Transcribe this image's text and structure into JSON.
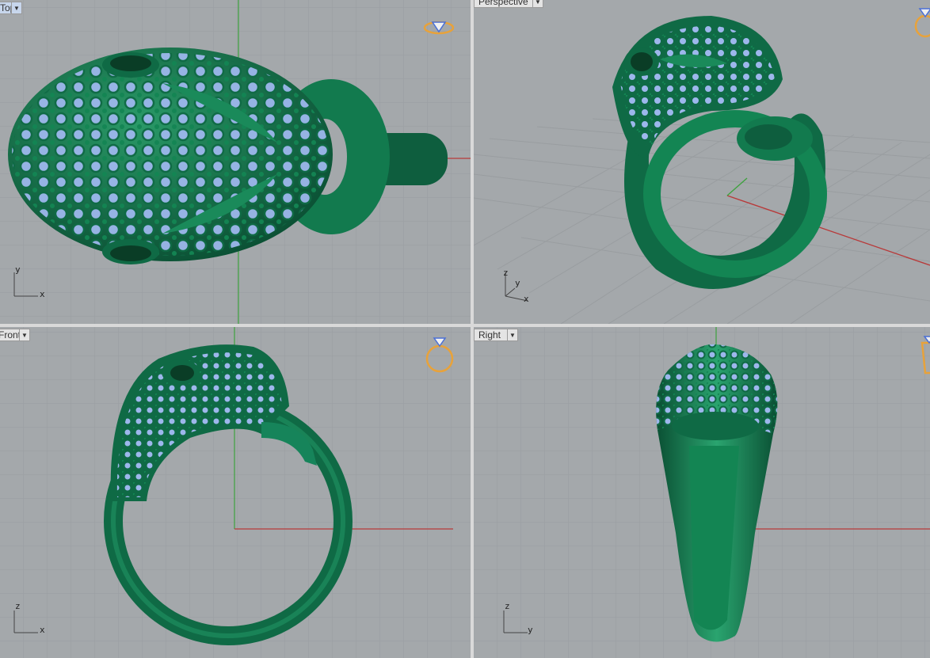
{
  "viewports": [
    {
      "id": "top",
      "label": "Top",
      "axes": {
        "a": "y",
        "b": "x"
      }
    },
    {
      "id": "perspective",
      "label": "Perspective",
      "axes": {
        "a": "z",
        "b": "y",
        "c": "x"
      }
    },
    {
      "id": "front",
      "label": "Front",
      "axes": {
        "a": "z",
        "b": "x"
      }
    },
    {
      "id": "right",
      "label": "Right",
      "axes": {
        "a": "z",
        "b": "y"
      }
    }
  ],
  "colors": {
    "viewport_bg": "#a4a8ab",
    "grid_minor": "#9a9ea1",
    "grid_major": "#8e9295",
    "axis_x": "#b83a3a",
    "axis_y": "#3ea23e",
    "metal": "#0f6a45",
    "metal_light": "#2fa06f",
    "gem": "#9db7ec",
    "ring_icon": "#e8a23a"
  }
}
